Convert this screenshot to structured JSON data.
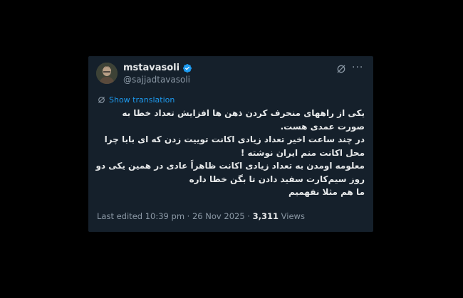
{
  "author": {
    "display_name": "mstavasoli",
    "handle": "@sajjadtavasoli",
    "verified": true,
    "avatar_icon": "avatar-photo"
  },
  "actions": {
    "grok_icon": "grok-icon",
    "more_icon": "more-icon",
    "more_label": "···"
  },
  "translation": {
    "label": "Show translation",
    "icon": "translate-icon"
  },
  "tweet": {
    "paragraphs": [
      "یکی از راههای منحرف کردن ذهن ها افزایش تعداد خطا به صورت عمدی هست.",
      "در چند ساعت اخیر تعداد زیادی اکانت توییت زدن که ای بابا چرا محل اکانت منم ایران نوشته !",
      "معلومه اومدن به تعداد زیادی اکانت ظاهراً عادی در همین یکی دو روز سیم‌کارت سفید دادن تا بگن خطا داره",
      "ما هم مثلا نفهمیم"
    ]
  },
  "meta": {
    "edited_prefix": "Last edited 10:39 pm · 26 Nov 2025 · ",
    "views_count": "3,311",
    "views_label": " Views"
  },
  "colors": {
    "page_bg": "#000000",
    "card_bg": "#15202b",
    "text_primary": "#e7e9ea",
    "text_secondary": "#8b98a5",
    "accent": "#1d9bf0"
  }
}
